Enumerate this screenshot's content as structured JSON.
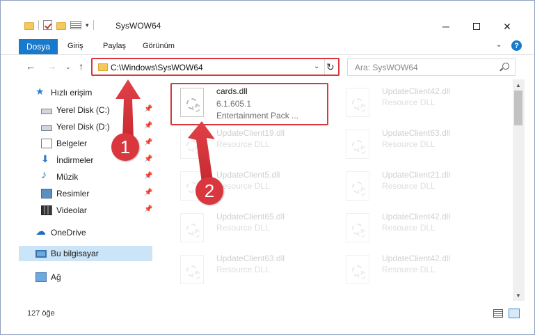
{
  "window": {
    "title": "SysWOW64",
    "minimize": "─",
    "close": "✕"
  },
  "ribbon": {
    "file_tab": "Dosya",
    "tabs": [
      "Giriş",
      "Paylaş",
      "Görünüm"
    ],
    "collapse": "⌄",
    "help": "?"
  },
  "nav": {
    "back": "←",
    "forward": "→",
    "recent": "⌄",
    "up": "↑",
    "address": "C:\\Windows\\SysWOW64",
    "address_dropdown": "⌄",
    "refresh": "↻",
    "search_placeholder": "Ara: SysWOW64"
  },
  "sidebar": {
    "pin_glyph": "📌",
    "items": [
      {
        "label": "Hızlı erişim",
        "icon": "star-icon"
      },
      {
        "label": "Yerel Disk (C:)",
        "icon": "disk-icon",
        "pinned": true
      },
      {
        "label": "Yerel Disk (D:)",
        "icon": "disk-icon",
        "pinned": true
      },
      {
        "label": "Belgeler",
        "icon": "document-icon",
        "pinned": true
      },
      {
        "label": "İndirmeler",
        "icon": "download-icon",
        "pinned": true
      },
      {
        "label": "Müzik",
        "icon": "music-icon",
        "pinned": true
      },
      {
        "label": "Resimler",
        "icon": "picture-icon",
        "pinned": true
      },
      {
        "label": "Videolar",
        "icon": "video-icon",
        "pinned": true
      },
      {
        "label": "OneDrive",
        "icon": "cloud-icon"
      },
      {
        "label": "Bu bilgisayar",
        "icon": "computer-icon",
        "selected": true
      },
      {
        "label": "Ağ",
        "icon": "network-icon"
      }
    ]
  },
  "files": {
    "cards": {
      "name": "cards.dll",
      "version": "6.1.605.1",
      "description": "Entertainment Pack ..."
    },
    "items": [
      {
        "name": "UpdateClient42.dll",
        "description": "Resource DLL"
      },
      {
        "name": "UpdateClient19.dll",
        "description": "Resource DLL"
      },
      {
        "name": "UpdateClient63.dll",
        "description": "Resource DLL"
      },
      {
        "name": "UpdateClient5.dll",
        "description": "Resource DLL"
      },
      {
        "name": "UpdateClient21.dll",
        "description": "Resource DLL"
      },
      {
        "name": "UpdateClient65.dll",
        "description": "Resource DLL"
      },
      {
        "name": "UpdateClient42.dll",
        "description": "Resource DLL"
      },
      {
        "name": "UpdateClient63.dll",
        "description": "Resource DLL"
      },
      {
        "name": "UpdateClient42.dll",
        "description": "Resource DLL"
      }
    ]
  },
  "status": {
    "count": "127 öğe"
  },
  "annotations": {
    "step1": "1",
    "step2": "2",
    "color": "#d9363e"
  },
  "scrollbar": {
    "up": "▲",
    "down": "▼"
  }
}
